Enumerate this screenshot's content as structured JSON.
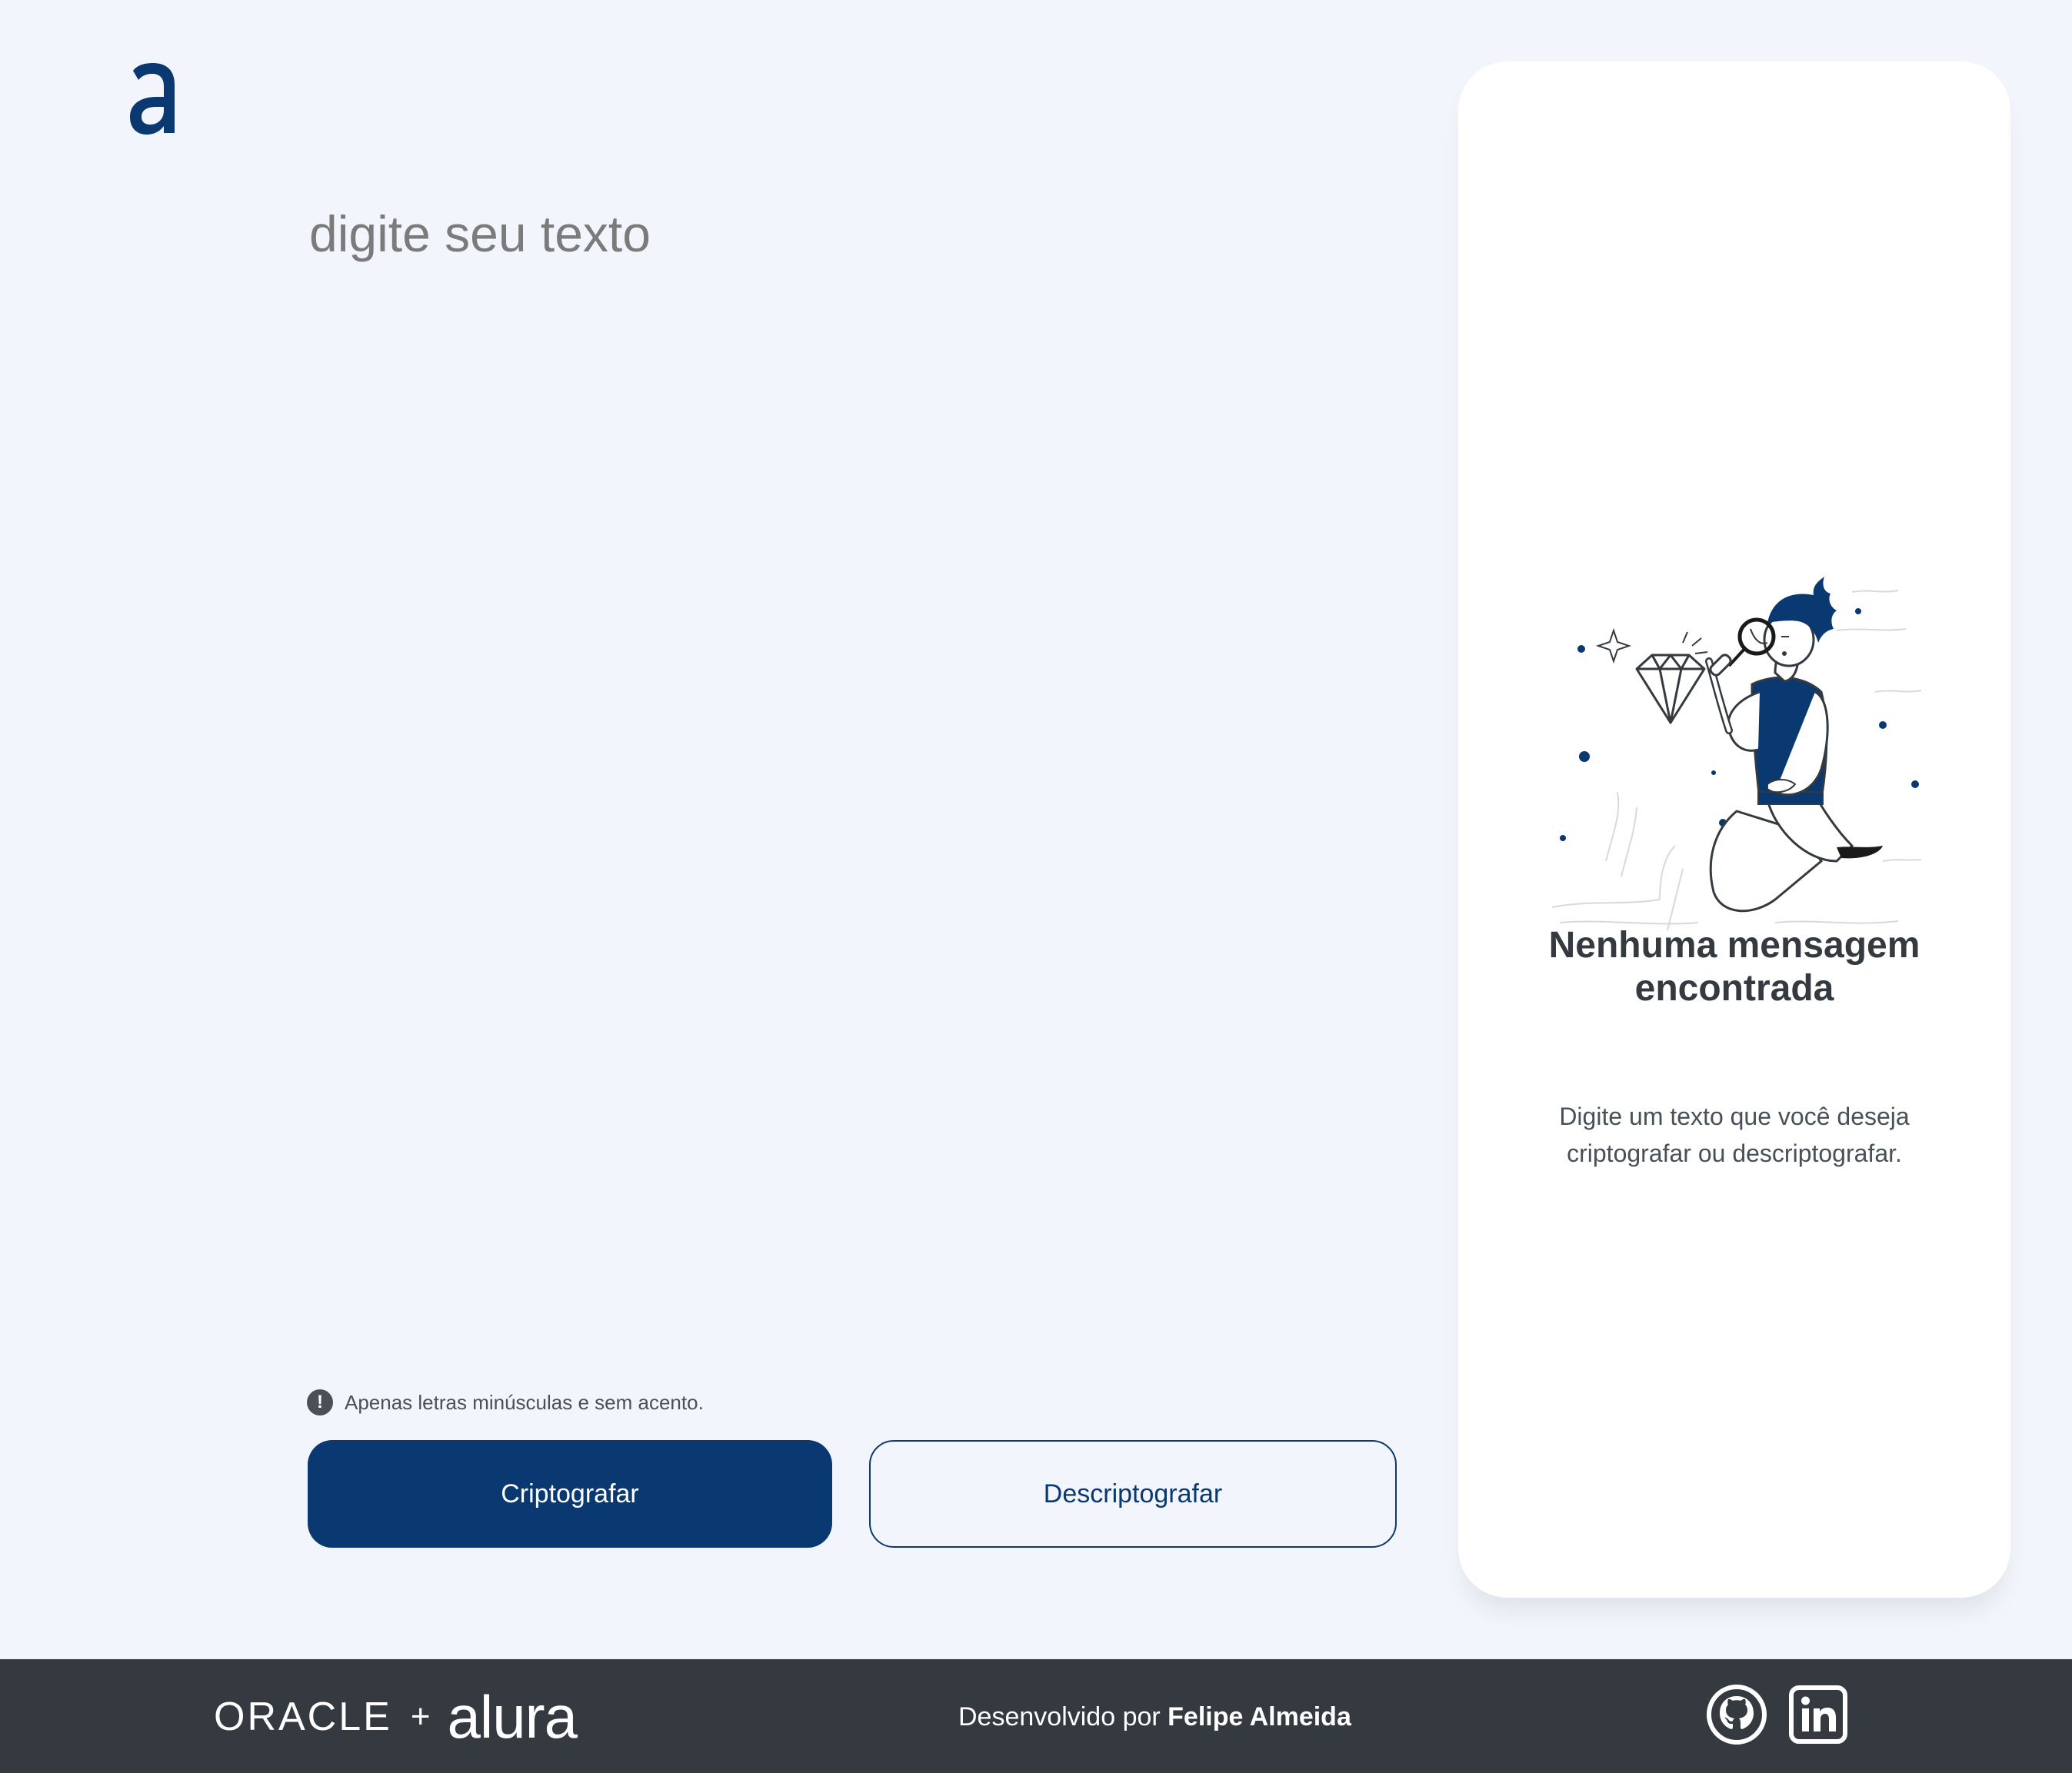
{
  "editor": {
    "placeholder": "digite seu texto",
    "value": "",
    "hint_text": "Apenas letras minúsculas e sem acento."
  },
  "actions": {
    "encrypt_label": "Criptografar",
    "decrypt_label": "Descriptografar"
  },
  "output": {
    "title": "Nenhuma mensagem encontrada",
    "description": "Digite um texto que você deseja criptografar ou descriptografar."
  },
  "footer": {
    "brand_oracle": "ORACLE",
    "brand_plus": "+",
    "brand_alura": "alura",
    "credit_prefix": "Desenvolvido por ",
    "credit_name": "Felipe Almeida"
  },
  "icons": {
    "logo": "alura-a-logo",
    "hint": "exclamation-circle-icon",
    "illustration": "person-magnifying-glass-illustration",
    "github": "github-icon",
    "linkedin": "linkedin-icon"
  },
  "colors": {
    "background": "#f3f5fc",
    "primary": "#0a3871",
    "panel": "#ffffff",
    "text": "#343a40",
    "footer": "#343a40"
  }
}
